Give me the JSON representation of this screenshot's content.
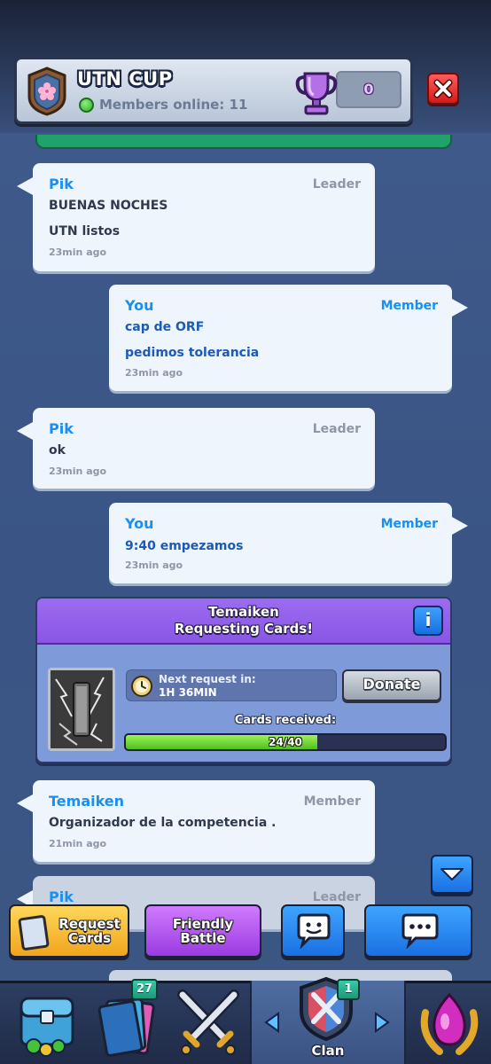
{
  "header": {
    "clan_name": "UTN CUP",
    "members_online": "Members online: 11",
    "trophies": "0"
  },
  "messages": [
    {
      "name": "Pik",
      "role": "Leader",
      "lines": [
        "BUENAS NOCHES",
        "UTN listos"
      ],
      "time": "23min ago",
      "side": "left"
    },
    {
      "name": "You",
      "role": "Member",
      "lines": [
        "cap de ORF",
        "pedimos tolerancia"
      ],
      "time": "23min ago",
      "side": "right"
    },
    {
      "name": "Pik",
      "role": "Leader",
      "lines": [
        "ok"
      ],
      "time": "23min ago",
      "side": "left"
    },
    {
      "name": "You",
      "role": "Member",
      "lines": [
        "9:40 empezamos"
      ],
      "time": "23min ago",
      "side": "right"
    },
    {
      "name": "Temaiken",
      "role": "Member",
      "lines": [
        "Organizador de la competencia ."
      ],
      "time": "21min ago",
      "side": "left"
    },
    {
      "name": "Pik",
      "role": "Leader",
      "lines": [],
      "time": "",
      "side": "left"
    }
  ],
  "request": {
    "player": "Temaiken",
    "title": "Requesting Cards!",
    "info_label": "i",
    "next_label": "Next request in:",
    "next_value": "1H 36MIN",
    "donate_label": "Donate",
    "received_label": "Cards received:",
    "received_text": "24/40",
    "received_fraction": 0.6
  },
  "actions": {
    "request_cards": "Request Cards",
    "request_cards_line1": "Request",
    "request_cards_line2": "Cards",
    "friendly_battle_line1": "Friendly",
    "friendly_battle_line2": "Battle"
  },
  "nav": {
    "cards_badge": "27",
    "clan_badge": "1",
    "clan_label": "Clan"
  },
  "colors": {
    "accent_blue": "#1a8ff0",
    "request_purple": "#9b6cf0",
    "request_cards_yellow": "#f5b531",
    "friendly_battle_purple": "#b65cf2",
    "progress_green": "#6fd83a"
  }
}
